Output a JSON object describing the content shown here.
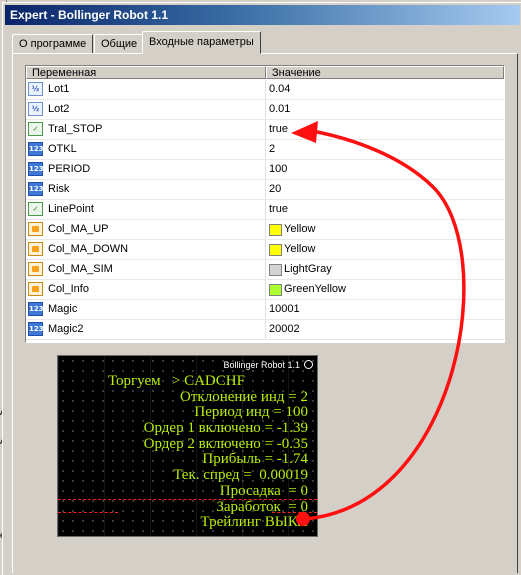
{
  "window": {
    "title": "Expert - Bollinger Robot 1.1"
  },
  "tabs": [
    {
      "label": "О программе"
    },
    {
      "label": "Общие"
    },
    {
      "label": "Входные параметры",
      "active": true
    }
  ],
  "grid": {
    "columns": [
      "Переменная",
      "Значение"
    ],
    "rows": [
      {
        "icon": "double-type-icon",
        "name": "Lot1",
        "value": "0.04"
      },
      {
        "icon": "double-type-icon",
        "name": "Lot2",
        "value": "0.01"
      },
      {
        "icon": "bool-type-icon",
        "name": "Tral_STOP",
        "value": "true"
      },
      {
        "icon": "int-type-icon",
        "name": "OTKL",
        "value": "2"
      },
      {
        "icon": "int-type-icon",
        "name": "PERIOD",
        "value": "100"
      },
      {
        "icon": "int-type-icon",
        "name": "Risk",
        "value": "20"
      },
      {
        "icon": "bool-type-icon",
        "name": "LinePoint",
        "value": "true"
      },
      {
        "icon": "color-type-icon",
        "name": "Col_MA_UP",
        "value": "Yellow",
        "swatch": "#ffff00"
      },
      {
        "icon": "color-type-icon",
        "name": "Col_MA_DOWN",
        "value": "Yellow",
        "swatch": "#ffff00"
      },
      {
        "icon": "color-type-icon",
        "name": "Col_MA_SIM",
        "value": "LightGray",
        "swatch": "#d3d3d3"
      },
      {
        "icon": "color-type-icon",
        "name": "Col_Info",
        "value": "GreenYellow",
        "swatch": "#adff2f"
      },
      {
        "icon": "int-type-icon",
        "name": "Magic",
        "value": "10001"
      },
      {
        "icon": "int-type-icon",
        "name": "Magic2",
        "value": "20002"
      }
    ]
  },
  "chart_panel": {
    "title": "Bollinger Robot 1.1",
    "text_color": "#b8f000",
    "lines": [
      "Торгуем   > CADCHF",
      "Отклонение инд = 2",
      "Период инд = 100",
      "Ордер 1 включено = -1.39",
      "Ордер 2 включено = -0.35",
      "Прибыль = -1.74",
      "Тек. спред =  0.00019",
      "Просадка  = 0",
      "Заработок  = 0",
      "Трейлинг ВЫКЛ"
    ]
  },
  "annotation": {
    "color": "#ff1010"
  }
}
